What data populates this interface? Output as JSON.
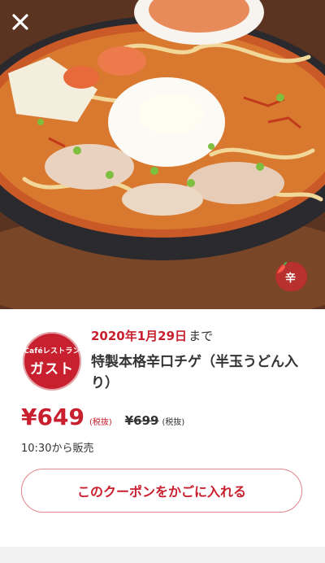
{
  "hero": {
    "close_icon": "close-icon",
    "spicy_badge": {
      "icon": "chili-pepper-icon",
      "label": "辛"
    }
  },
  "brand": {
    "logo_top": "Caféレストラン",
    "logo_main": "ガスト"
  },
  "coupon": {
    "deadline_date": "2020年1月29日",
    "deadline_suffix": "まで",
    "product_name": "特製本格辛口チゲ（半玉うどん入り）",
    "price": "¥649",
    "price_tax_note": "(税抜)",
    "original_price": "¥699",
    "original_price_tax_note": "(税抜)",
    "sale_time": "10:30から販売",
    "add_to_cart_label": "このクーポンをかごに入れる"
  },
  "colors": {
    "accent": "#c8202e",
    "badge": "#b8312f",
    "button_border": "#e0858a"
  }
}
